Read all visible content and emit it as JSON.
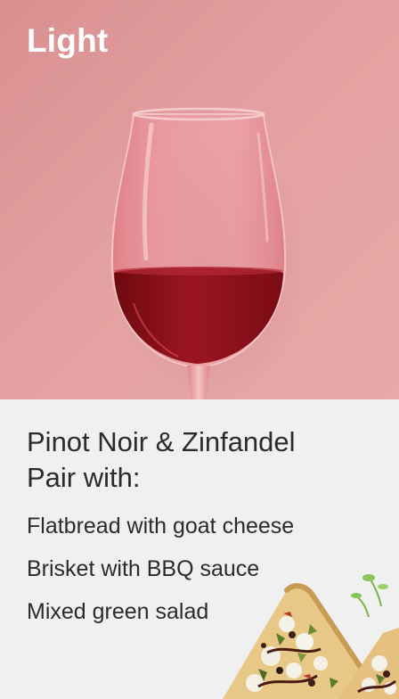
{
  "hero": {
    "title": "Light"
  },
  "pairing": {
    "wine_line": "Pinot Noir & Zinfandel",
    "pair_line": "Pair with:",
    "items": [
      "Flatbread with goat cheese",
      "Brisket with BBQ sauce",
      "Mixed green salad"
    ]
  },
  "colors": {
    "hero_background": "#e3a0a0",
    "wine": "#8c0d16",
    "panel_background": "#f0f0f0",
    "text": "#2b2b2b",
    "title": "#ffffff"
  }
}
